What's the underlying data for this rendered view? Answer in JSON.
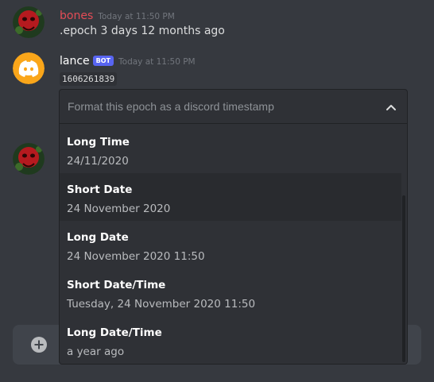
{
  "messages": [
    {
      "author": "bones",
      "timestamp": "Today at 11:50 PM",
      "content": ".epoch 3 days 12 months ago"
    },
    {
      "author": "lance",
      "badge": "BOT",
      "timestamp": "Today at 11:50 PM",
      "content": "1606261839"
    }
  ],
  "select": {
    "placeholder": "Format this epoch as a discord timestamp",
    "expanded": true,
    "options": [
      {
        "label": "Long Time",
        "value": "24/11/2020"
      },
      {
        "label": "Short Date",
        "value": "24 November 2020"
      },
      {
        "label": "Long Date",
        "value": "24 November 2020 11:50"
      },
      {
        "label": "Short Date/Time",
        "value": "Tuesday, 24 November 2020 11:50"
      },
      {
        "label": "Long Date/Time",
        "value": "a year ago"
      }
    ]
  },
  "colors": {
    "background": "#36393f",
    "bones_name": "#e34c56",
    "bot_badge": "#5865f2",
    "discord_avatar": "#faa61a",
    "dropdown_bg": "#2f3136"
  },
  "icons": {
    "select_toggle": "chevron-up-icon",
    "composer_add": "plus-circle-icon",
    "bot_avatar": "discord-logo-icon"
  }
}
